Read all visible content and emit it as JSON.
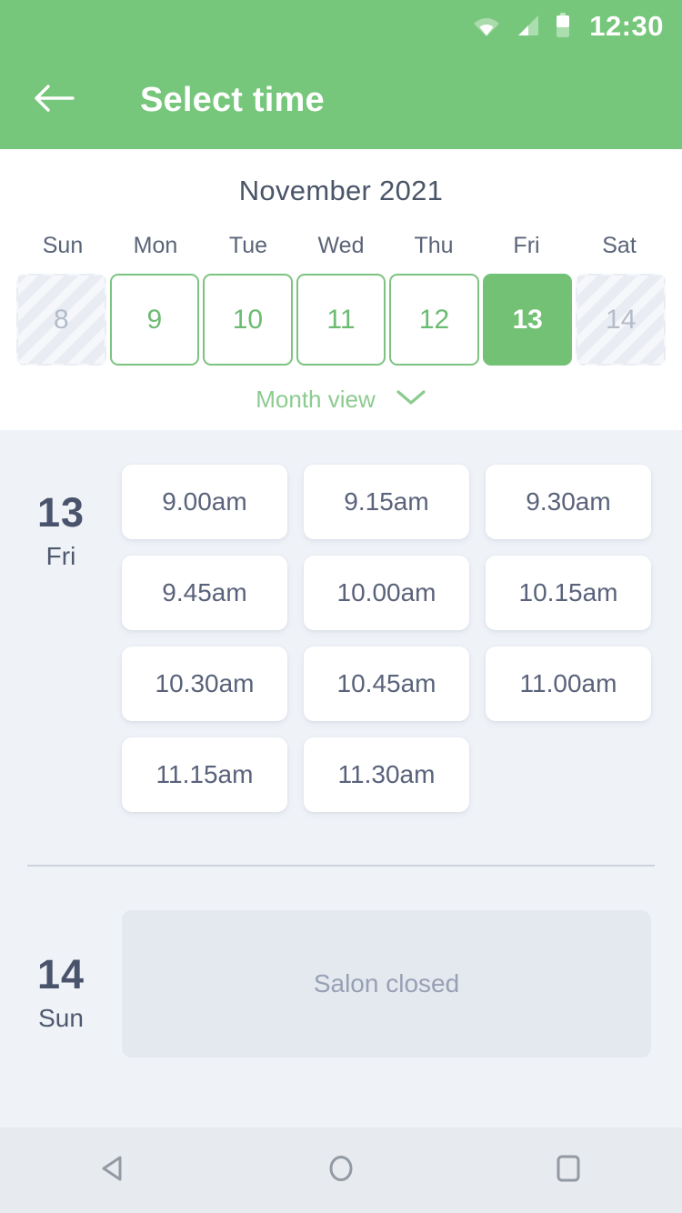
{
  "status_bar": {
    "time": "12:30",
    "icons": [
      "wifi-icon",
      "cell-signal-icon",
      "battery-icon"
    ]
  },
  "app_bar": {
    "back_icon": "arrow-left-icon",
    "title": "Select time"
  },
  "calendar": {
    "month_title": "November 2021",
    "weekdays": [
      "Sun",
      "Mon",
      "Tue",
      "Wed",
      "Thu",
      "Fri",
      "Sat"
    ],
    "days": [
      {
        "label": "8",
        "state": "disabled"
      },
      {
        "label": "9",
        "state": "available"
      },
      {
        "label": "10",
        "state": "available"
      },
      {
        "label": "11",
        "state": "available"
      },
      {
        "label": "12",
        "state": "available"
      },
      {
        "label": "13",
        "state": "selected"
      },
      {
        "label": "14",
        "state": "disabled"
      }
    ],
    "month_view_label": "Month view",
    "month_view_icon": "chevron-down-icon"
  },
  "schedule": {
    "day_13": {
      "day_number": "13",
      "day_name": "Fri",
      "slots": [
        "9.00am",
        "9.15am",
        "9.30am",
        "9.45am",
        "10.00am",
        "10.15am",
        "10.30am",
        "10.45am",
        "11.00am",
        "11.15am",
        "11.30am"
      ]
    },
    "day_14": {
      "day_number": "14",
      "day_name": "Sun",
      "closed_label": "Salon closed"
    }
  },
  "nav_bar": {
    "back_icon": "nav-back-triangle-icon",
    "home_icon": "nav-home-circle-icon",
    "recents_icon": "nav-recents-square-icon"
  },
  "colors": {
    "brand_green": "#76c67b",
    "selected_green": "#73c174",
    "light_green_text": "#8ccb90",
    "body_bg": "#eff2f7",
    "slate_text": "#4a5568",
    "muted_text": "#97a1b4"
  }
}
